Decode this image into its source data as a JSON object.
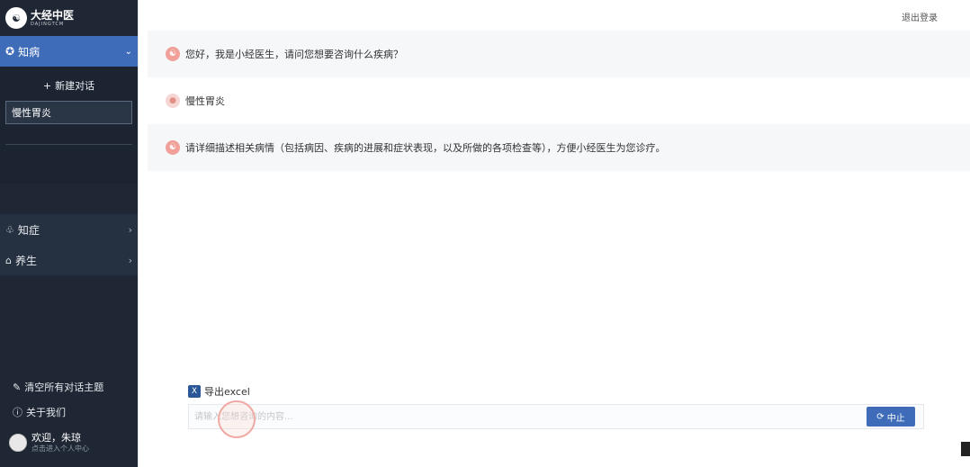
{
  "logo": {
    "mark": "☯",
    "name_cn": "大经中医",
    "name_en": "DAJINGTCM"
  },
  "sidebar": {
    "active_menu": {
      "label": "知病",
      "icon": "target-icon",
      "chevron": "⌄"
    },
    "new_chat_label": "新建对话",
    "conversations": [
      {
        "label": "慢性胃炎"
      }
    ],
    "menu_items": [
      {
        "label": "知症",
        "icon": "symptom-icon",
        "chevron": "›"
      },
      {
        "label": "养生",
        "icon": "health-icon",
        "chevron": "›"
      }
    ],
    "clear_all_label": "清空所有对话主题",
    "about_label": "关于我们",
    "user": {
      "greeting": "欢迎，朱琼",
      "subtitle": "点击进入个人中心"
    }
  },
  "main": {
    "logout_label": "退出登录",
    "messages": [
      {
        "role": "bot",
        "text": "您好，我是小经医生，请问您想要咨询什么疾病？"
      },
      {
        "role": "user",
        "text": "慢性胃炎"
      },
      {
        "role": "bot",
        "text": "请详细描述相关病情（包括病因、疾病的进展和症状表现，以及所做的各项检查等），方便小经医生为您诊疗。"
      }
    ],
    "export_label": "导出excel",
    "input": {
      "placeholder": "请输入您想咨询的内容...",
      "value": ""
    },
    "stop_label": "中止"
  },
  "colors": {
    "sidebar_bg": "#1e2733",
    "accent": "#3f6cb8",
    "bot_row_bg": "#f5f7f9",
    "avatar_bot": "#f1a09a"
  }
}
